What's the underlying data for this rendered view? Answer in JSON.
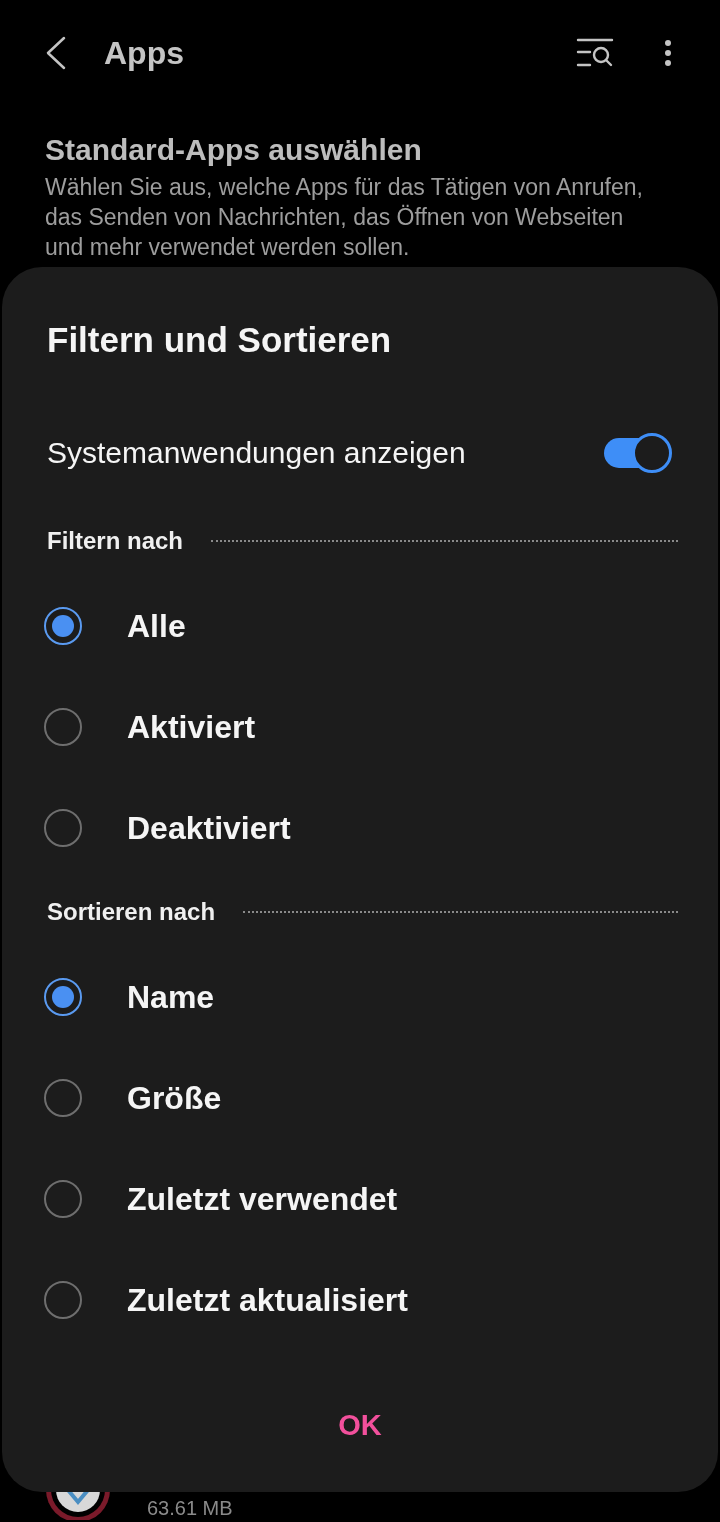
{
  "header": {
    "title": "Apps"
  },
  "page": {
    "heading": "Standard-Apps auswählen",
    "description": "Wählen Sie aus, welche Apps für das Tätigen von Anrufen, das Senden von Nachrichten, das Öffnen von Webseiten und mehr verwendet werden sollen.",
    "app_size": "63.61 MB"
  },
  "sheet": {
    "title": "Filtern und Sortieren",
    "toggle": {
      "label": "Systemanwendungen anzeigen",
      "on": true
    },
    "sections": [
      {
        "heading": "Filtern nach",
        "options": [
          {
            "label": "Alle",
            "selected": true
          },
          {
            "label": "Aktiviert",
            "selected": false
          },
          {
            "label": "Deaktiviert",
            "selected": false
          }
        ]
      },
      {
        "heading": "Sortieren nach",
        "options": [
          {
            "label": "Name",
            "selected": true
          },
          {
            "label": "Größe",
            "selected": false
          },
          {
            "label": "Zuletzt verwendet",
            "selected": false
          },
          {
            "label": "Zuletzt aktualisiert",
            "selected": false
          }
        ]
      }
    ],
    "button": "OK"
  }
}
